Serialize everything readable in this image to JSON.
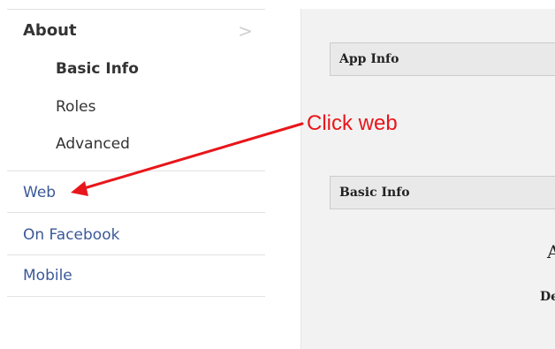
{
  "sidebar": {
    "section": {
      "label": "About",
      "chevron": "chevron-right-icon",
      "chevron_glyph": ">"
    },
    "subitems": [
      {
        "label": "Basic Info",
        "active": true
      },
      {
        "label": "Roles",
        "active": false
      },
      {
        "label": "Advanced",
        "active": false
      }
    ],
    "links": [
      {
        "label": "Web"
      },
      {
        "label": "On Facebook"
      },
      {
        "label": "Mobile"
      }
    ]
  },
  "main": {
    "panels": [
      {
        "title": "App Info"
      },
      {
        "title": "Basic Info"
      }
    ],
    "clipped_text": {
      "large": "A",
      "bold": "De"
    }
  },
  "annotation": {
    "text": "Click web",
    "color": "#e8161b"
  },
  "colors": {
    "link": "#3b5998",
    "text": "#333333",
    "panel_bg": "#f2f2f2",
    "panel_head_bg": "#e9e9e9"
  }
}
